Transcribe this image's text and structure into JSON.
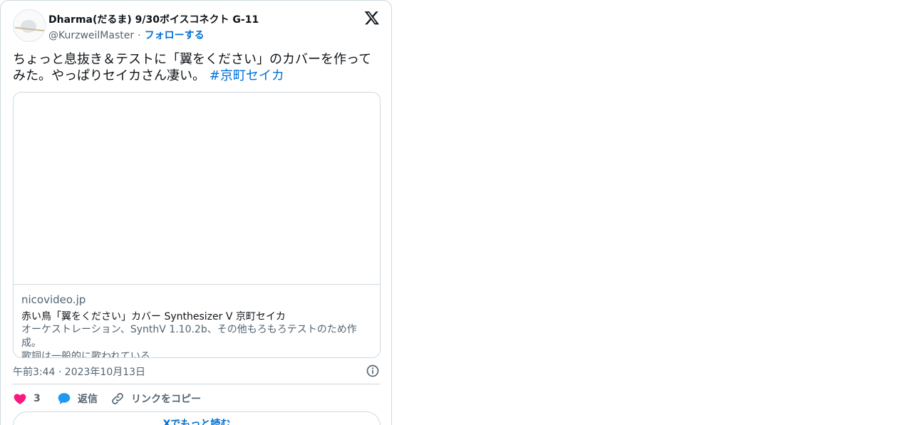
{
  "user": {
    "display_name": "Dharma(だるま) 9/30ボイスコネクト G-11",
    "handle": "@KurzweilMaster",
    "separator": "·",
    "follow_label": "フォローする"
  },
  "tweet": {
    "text": "ちょっと息抜き＆テストに「翼をください」のカバーを作ってみた。やっぱりセイカさん凄い。",
    "hashtag": "#京町セイカ"
  },
  "link_card": {
    "domain": "nicovideo.jp",
    "title": "赤い鳥「翼をください」カバー Synthesizer V 京町セイカ",
    "description_line1": "オーケストレーション、SynthV 1.10.2b、その他もろもろテストのため作成。",
    "description_line2": "歌詞は一般的に歌われている..."
  },
  "meta": {
    "timestamp": "午前3:44 · 2023年10月13日"
  },
  "actions": {
    "like_count": "3",
    "reply_label": "返信",
    "copy_label": "リンクをコピー"
  },
  "footer": {
    "read_more_label": "Xでもっと読む"
  },
  "colors": {
    "accent": "#006fd6",
    "like": "#f91880",
    "reply": "#1d9bf0",
    "muted": "#536471",
    "border": "#cfd9de"
  },
  "icons": [
    "x-logo-icon",
    "info-icon",
    "heart-icon",
    "speech-bubble-icon",
    "link-icon"
  ]
}
